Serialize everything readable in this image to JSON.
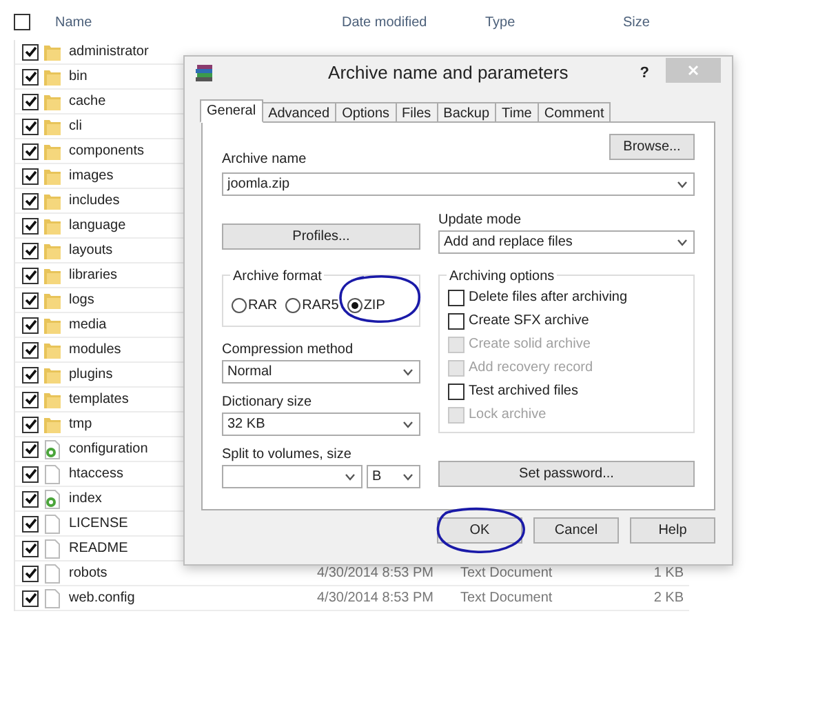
{
  "explorer": {
    "header": {
      "checked": false,
      "columns": [
        "Name",
        "Date modified",
        "Type",
        "Size"
      ]
    },
    "rows": [
      {
        "name": "administrator",
        "kind": "folder",
        "checked": true
      },
      {
        "name": "bin",
        "kind": "folder",
        "checked": true
      },
      {
        "name": "cache",
        "kind": "folder",
        "checked": true
      },
      {
        "name": "cli",
        "kind": "folder",
        "checked": true
      },
      {
        "name": "components",
        "kind": "folder",
        "checked": true
      },
      {
        "name": "images",
        "kind": "folder",
        "checked": true
      },
      {
        "name": "includes",
        "kind": "folder",
        "checked": true
      },
      {
        "name": "language",
        "kind": "folder",
        "checked": true
      },
      {
        "name": "layouts",
        "kind": "folder",
        "checked": true
      },
      {
        "name": "libraries",
        "kind": "folder",
        "checked": true
      },
      {
        "name": "logs",
        "kind": "folder",
        "checked": true
      },
      {
        "name": "media",
        "kind": "folder",
        "checked": true
      },
      {
        "name": "modules",
        "kind": "folder",
        "checked": true
      },
      {
        "name": "plugins",
        "kind": "folder",
        "checked": true
      },
      {
        "name": "templates",
        "kind": "folder",
        "checked": true
      },
      {
        "name": "tmp",
        "kind": "folder",
        "checked": true
      },
      {
        "name": "configuration",
        "kind": "script",
        "checked": true
      },
      {
        "name": "htaccess",
        "kind": "text",
        "checked": true
      },
      {
        "name": "index",
        "kind": "script",
        "checked": true
      },
      {
        "name": "LICENSE",
        "kind": "text",
        "checked": true
      },
      {
        "name": "README",
        "kind": "text",
        "checked": true
      },
      {
        "name": "robots",
        "kind": "text",
        "checked": true,
        "date": "4/30/2014 8:53 PM",
        "type": "Text Document",
        "size": "1 KB"
      },
      {
        "name": "web.config",
        "kind": "text",
        "checked": true,
        "date": "4/30/2014 8:53 PM",
        "type": "Text Document",
        "size": "2 KB"
      }
    ]
  },
  "dialog": {
    "title": "Archive name and parameters",
    "help": "?",
    "tabs": [
      {
        "label": "General",
        "selected": true
      },
      {
        "label": "Advanced",
        "selected": false
      },
      {
        "label": "Options",
        "selected": false
      },
      {
        "label": "Files",
        "selected": false
      },
      {
        "label": "Backup",
        "selected": false
      },
      {
        "label": "Time",
        "selected": false
      },
      {
        "label": "Comment",
        "selected": false
      }
    ],
    "archive_name": {
      "label": "Archive name",
      "value": "joomla.zip"
    },
    "browse": "Browse...",
    "profiles": "Profiles...",
    "update_mode": {
      "label": "Update mode",
      "value": "Add and replace files"
    },
    "archive_format": {
      "label": "Archive format",
      "options": [
        {
          "label": "RAR",
          "selected": false
        },
        {
          "label": "RAR5",
          "selected": false
        },
        {
          "label": "ZIP",
          "selected": true
        }
      ]
    },
    "compression": {
      "label": "Compression method",
      "value": "Normal"
    },
    "dictionary": {
      "label": "Dictionary size",
      "value": "32 KB"
    },
    "split": {
      "label": "Split to volumes, size",
      "unit": "B"
    },
    "archiving_options": {
      "label": "Archiving options",
      "items": [
        {
          "label": "Delete files after archiving",
          "checked": false,
          "disabled": false
        },
        {
          "label": "Create SFX archive",
          "checked": false,
          "disabled": false
        },
        {
          "label": "Create solid archive",
          "checked": false,
          "disabled": true
        },
        {
          "label": "Add recovery record",
          "checked": false,
          "disabled": true
        },
        {
          "label": "Test archived files",
          "checked": false,
          "disabled": false
        },
        {
          "label": "Lock archive",
          "checked": false,
          "disabled": true
        }
      ]
    },
    "set_password": "Set password...",
    "buttons": [
      "OK",
      "Cancel",
      "Help"
    ]
  }
}
